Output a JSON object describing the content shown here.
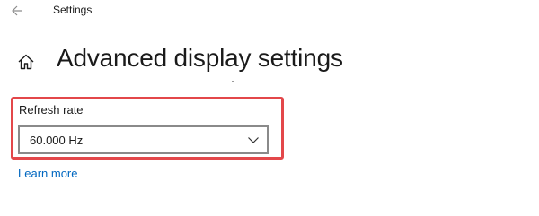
{
  "window": {
    "app_title": "Settings"
  },
  "header": {
    "back_icon": "back-arrow-icon",
    "home_icon": "home-icon",
    "page_title": "Advanced display settings"
  },
  "refresh_rate": {
    "label": "Refresh rate",
    "selected_value": "60.000 Hz",
    "dropdown_icon": "chevron-down-icon",
    "highlight_color": "#e3474a"
  },
  "links": {
    "learn_more": "Learn more",
    "link_color": "#0067c0"
  }
}
